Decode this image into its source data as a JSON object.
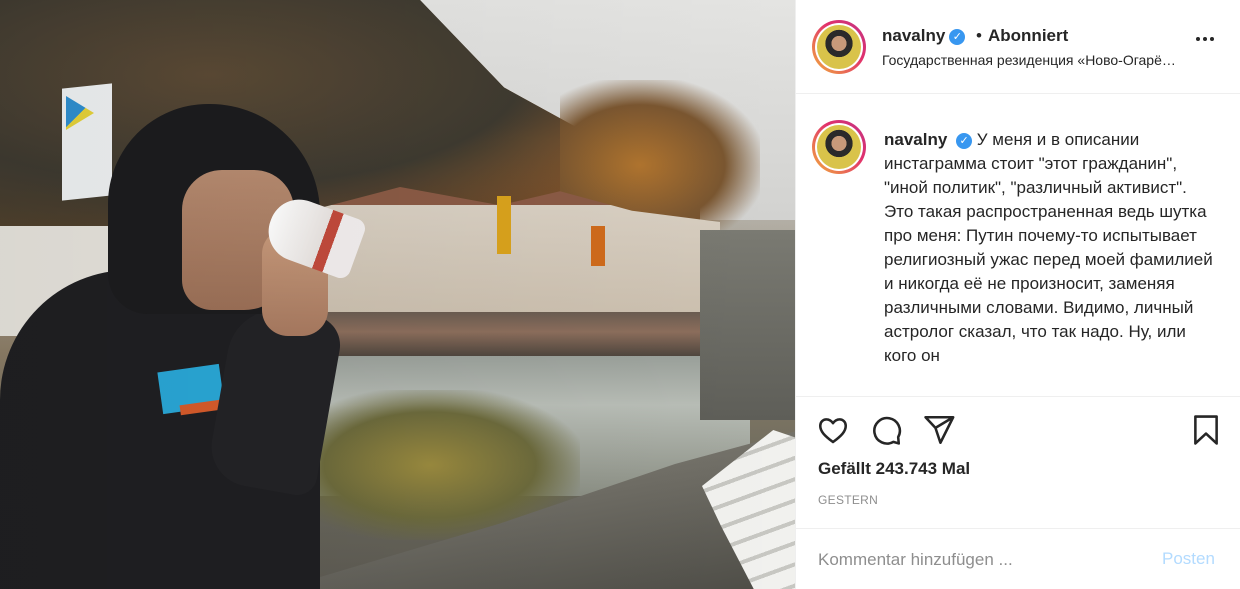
{
  "post": {
    "username": "navalny",
    "verified_mark": "✓",
    "separator": "•",
    "follow_status": "Abonniert",
    "location": "Государственная резиденция «Ново-Огарё…"
  },
  "caption": {
    "username": "navalny",
    "text": "У меня и в описании инстаграмма стоит \"этот гражданин\", \"иной политик\", \"различный активист\". Это такая распространенная ведь шутка про меня: Путин почему-то испытывает религиозный ужас перед моей фамилией и никогда её не произносит, заменяя различными словами. Видимо, личный астролог сказал, что так надо. Ну, или кого он"
  },
  "actions": {
    "icons": [
      "heart-icon",
      "comment-icon",
      "share-icon",
      "bookmark-icon"
    ],
    "likes": "Gefällt 243.743 Mal",
    "date": "GESTERN"
  },
  "comment": {
    "placeholder": "Kommentar hinzufügen ...",
    "post_label": "Posten"
  },
  "colors": {
    "accent": "#3897f0",
    "post_disabled": "#b3dbff",
    "muted": "#8e8e8e",
    "text": "#262626"
  }
}
